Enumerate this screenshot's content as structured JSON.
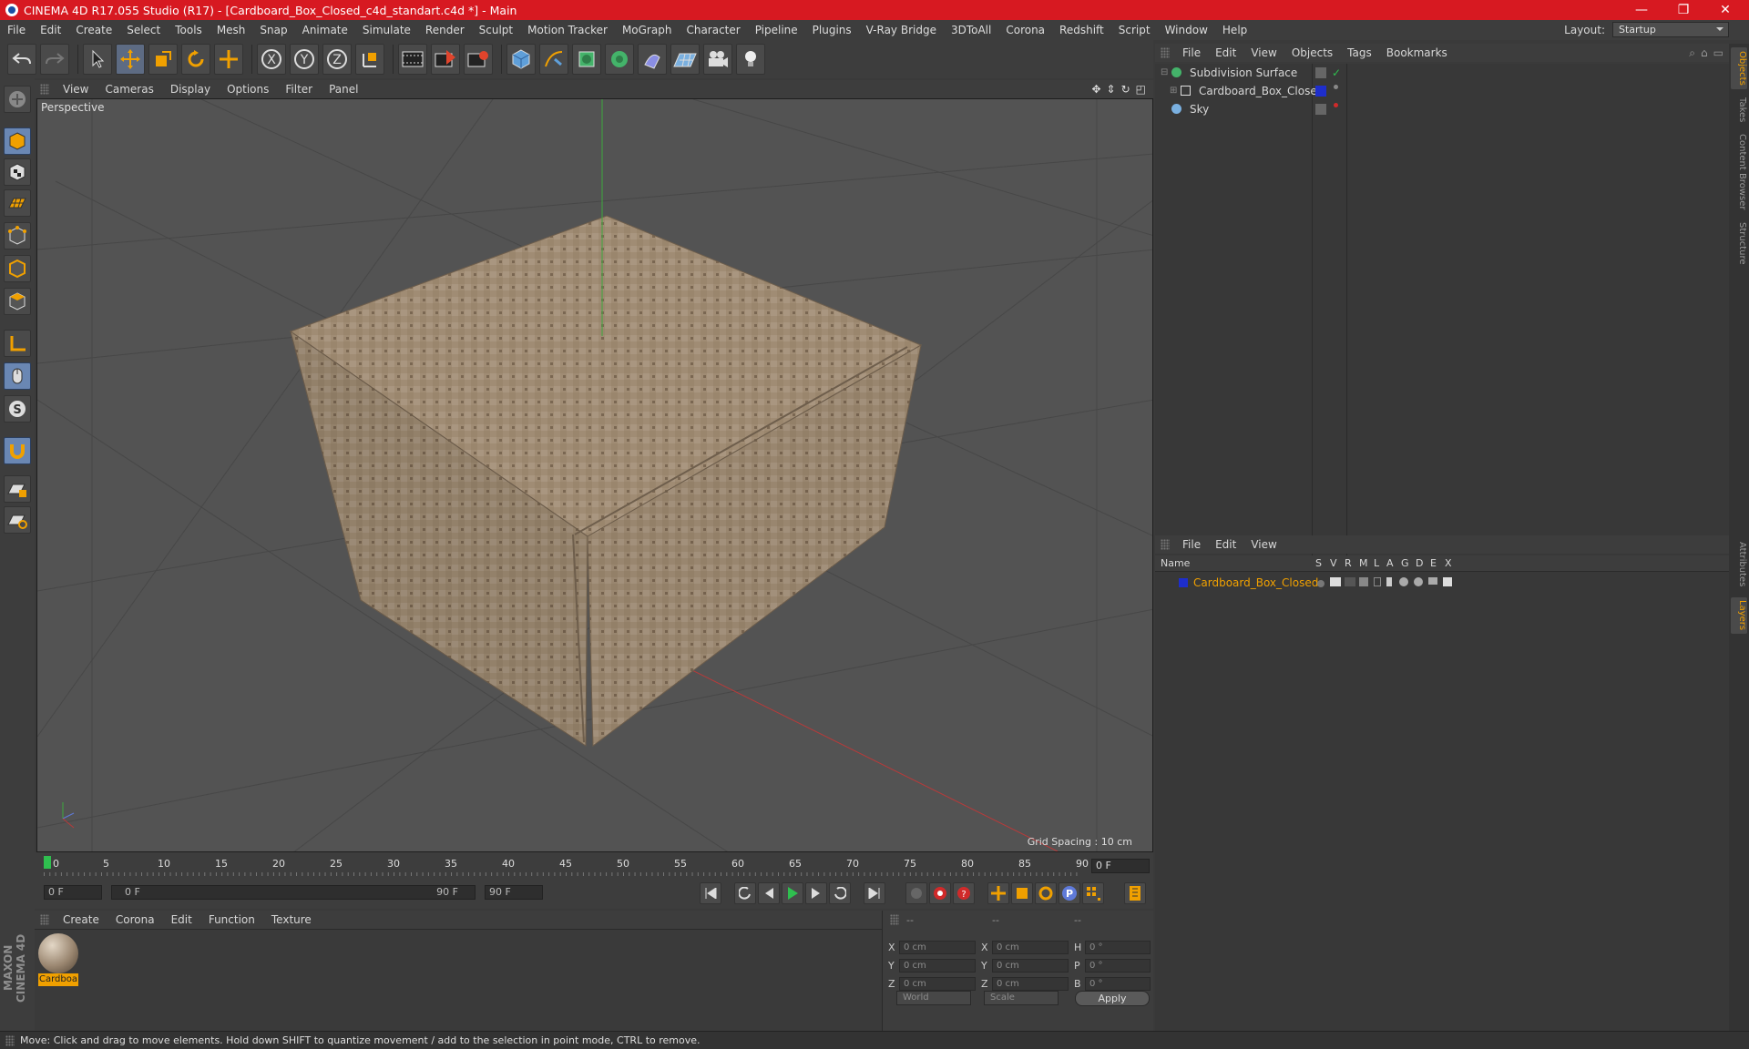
{
  "titlebar": {
    "title": "CINEMA 4D R17.055 Studio (R17) - [Cardboard_Box_Closed_c4d_standart.c4d *] - Main",
    "minimize": "—",
    "maximize": "❐",
    "close": "✕"
  },
  "menubar": {
    "items": [
      "File",
      "Edit",
      "Create",
      "Select",
      "Tools",
      "Mesh",
      "Snap",
      "Animate",
      "Simulate",
      "Render",
      "Sculpt",
      "Motion Tracker",
      "MoGraph",
      "Character",
      "Pipeline",
      "Plugins",
      "V-Ray Bridge",
      "3DToAll",
      "Corona",
      "Redshift",
      "Script",
      "Window",
      "Help"
    ]
  },
  "layout": {
    "label": "Layout:",
    "value": "Startup"
  },
  "toolbar": {
    "axis_x": "X",
    "axis_y": "Y",
    "axis_z": "Z"
  },
  "viewport": {
    "menu": [
      "View",
      "Cameras",
      "Display",
      "Options",
      "Filter",
      "Panel"
    ],
    "label": "Perspective",
    "grid_spacing": "Grid Spacing : 10 cm"
  },
  "timeline": {
    "ticks": [
      "0",
      "5",
      "10",
      "15",
      "20",
      "25",
      "30",
      "35",
      "40",
      "45",
      "50",
      "55",
      "60",
      "65",
      "70",
      "75",
      "80",
      "85",
      "90"
    ],
    "current_frame": "0 F"
  },
  "transport": {
    "start": "0 F",
    "range_start": "0 F",
    "range_end": "90 F",
    "end": "90 F"
  },
  "material_manager": {
    "menu": [
      "Create",
      "Corona",
      "Edit",
      "Function",
      "Texture"
    ],
    "materials": [
      {
        "name": "Cardboa"
      }
    ]
  },
  "coordinates": {
    "hdr1": "--",
    "hdr2": "--",
    "hdr3": "--",
    "rows": [
      {
        "l1": "X",
        "v1": "0 cm",
        "l2": "X",
        "v2": "0 cm",
        "l3": "H",
        "v3": "0 °"
      },
      {
        "l1": "Y",
        "v1": "0 cm",
        "l2": "Y",
        "v2": "0 cm",
        "l3": "P",
        "v3": "0 °"
      },
      {
        "l1": "Z",
        "v1": "0 cm",
        "l2": "Z",
        "v2": "0 cm",
        "l3": "B",
        "v3": "0 °"
      }
    ],
    "mode": "World",
    "scale": "Scale",
    "apply": "Apply"
  },
  "object_manager": {
    "menu": [
      "File",
      "Edit",
      "View",
      "Objects",
      "Tags",
      "Bookmarks"
    ],
    "objects": [
      {
        "name": "Subdivision Surface"
      },
      {
        "name": "Cardboard_Box_Closed"
      },
      {
        "name": "Sky"
      }
    ]
  },
  "layer_manager": {
    "menu": [
      "File",
      "Edit",
      "View"
    ],
    "columns": {
      "name": "Name",
      "flags": [
        "S",
        "V",
        "R",
        "M",
        "L",
        "A",
        "G",
        "D",
        "E",
        "X"
      ]
    },
    "layers": [
      {
        "name": "Cardboard_Box_Closed"
      }
    ]
  },
  "side_tabs": [
    "Objects",
    "Takes",
    "Content Browser",
    "Structure",
    "Attributes",
    "Layers"
  ],
  "brand": {
    "maxon": "MAXON CINEMA 4D"
  },
  "status": {
    "text": "Move: Click and drag to move elements. Hold down SHIFT to quantize movement / add to the selection in point mode, CTRL to remove."
  },
  "colors": {
    "title_red": "#d71921",
    "accent_orange": "#f0a000",
    "selected_blue": "#6a87b3",
    "layer_blue": "#1e2ecc"
  }
}
